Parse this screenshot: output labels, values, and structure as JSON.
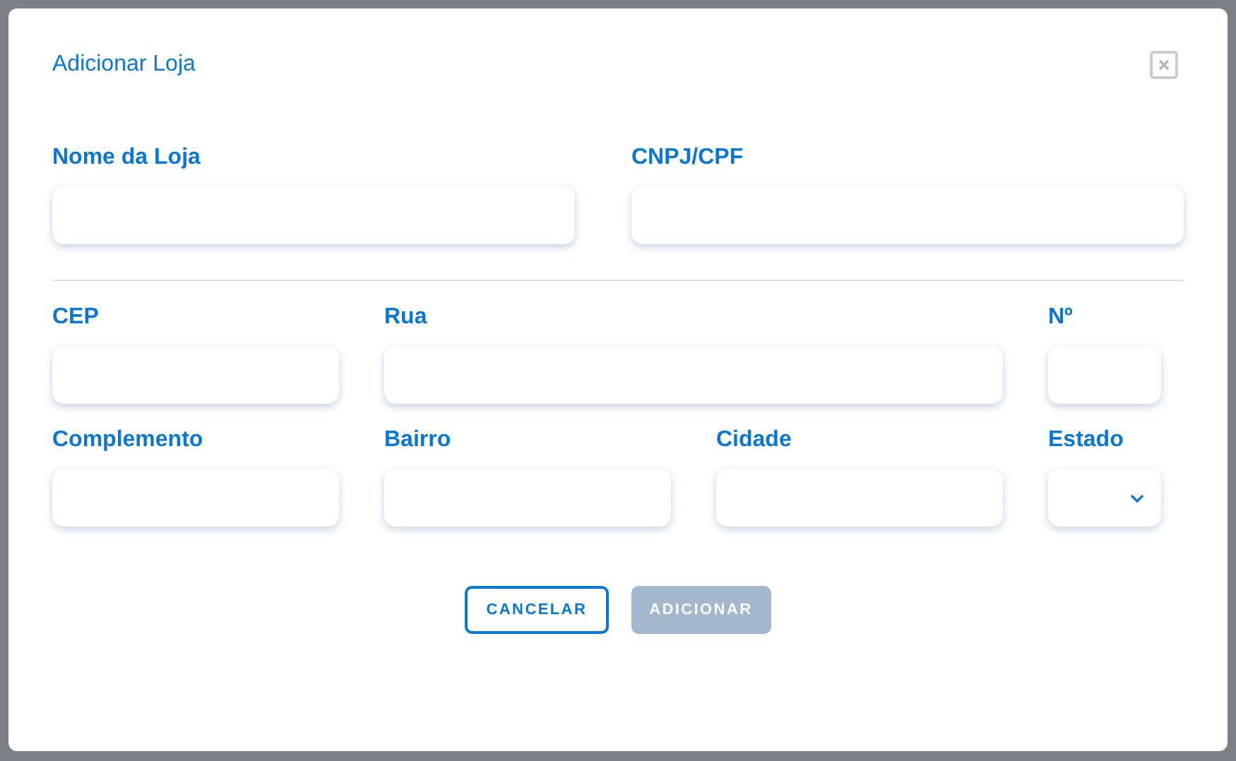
{
  "dialog": {
    "title": "Adicionar Loja"
  },
  "rows": [
    [
      {
        "label": "Nome da Loja",
        "kind": "text"
      },
      {
        "label": "CNPJ/CPF",
        "kind": "text"
      }
    ],
    [
      {
        "label": "CEP",
        "kind": "text"
      },
      {
        "label": "Rua",
        "kind": "text"
      },
      {
        "label": "Nº",
        "kind": "text"
      }
    ],
    [
      {
        "label": "Complemento",
        "kind": "text"
      },
      {
        "label": "Bairro",
        "kind": "text"
      },
      {
        "label": "Cidade",
        "kind": "text"
      },
      {
        "label": "Estado",
        "kind": "select"
      }
    ]
  ],
  "buttons": [
    {
      "label": "CANCELAR",
      "kind": "outline",
      "disabled": false
    },
    {
      "label": "ADICIONAR",
      "kind": "primary",
      "disabled": true
    }
  ]
}
